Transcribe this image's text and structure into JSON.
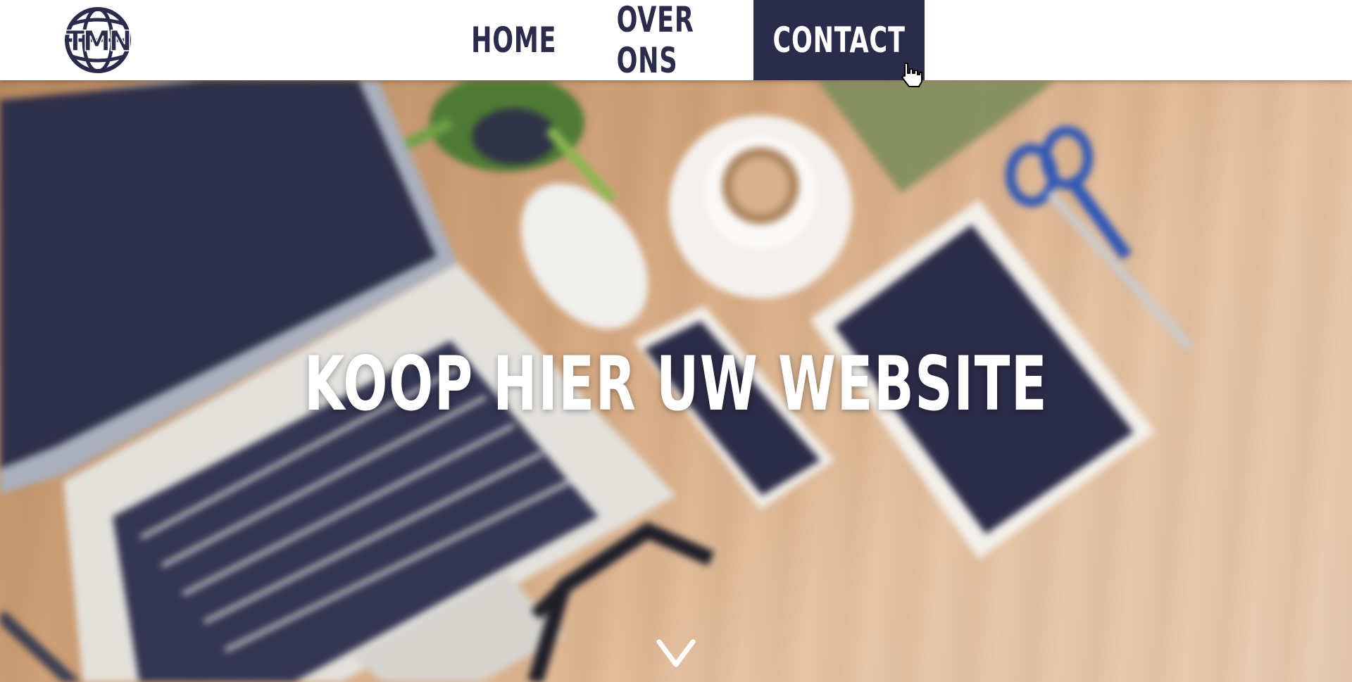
{
  "header": {
    "logo_text": "TMN",
    "nav": [
      {
        "label": "HOME"
      },
      {
        "label": "OVER ONS"
      },
      {
        "label": "CONTACT"
      }
    ],
    "active_nav": "CONTACT"
  },
  "hero": {
    "title": "KOOP HIER UW WEBSITE",
    "scroll_icon": "chevron-down-icon"
  },
  "colors": {
    "brand": "#2b2b4b",
    "header_bg": "#ffffff",
    "hero_text": "#ffffff"
  }
}
